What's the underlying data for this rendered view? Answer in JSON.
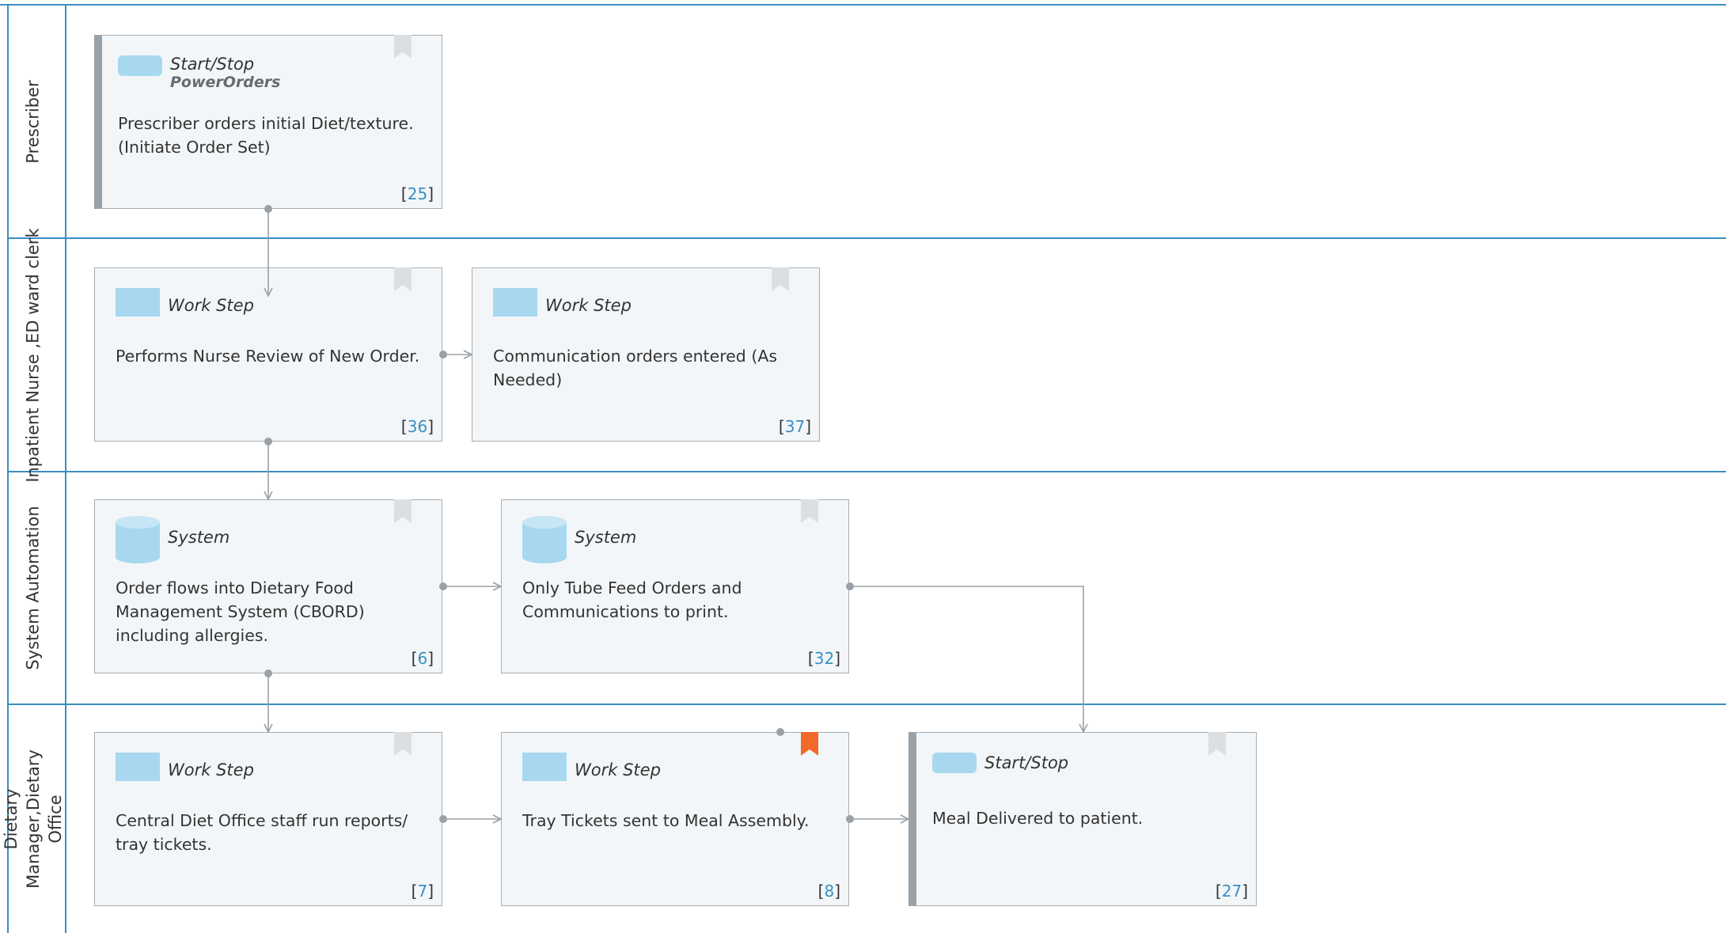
{
  "lanes": [
    {
      "label": "Prescriber"
    },
    {
      "label": "Inpatient Nurse ,ED ward clerk"
    },
    {
      "label": "System Automation"
    },
    {
      "label": "Dietary Manager,Dietary Office"
    }
  ],
  "nodes": [
    {
      "kind": "Start/Stop",
      "subkind": "PowerOrders",
      "desc": "Prescriber orders initial Diet/texture. (Initiate Order Set)",
      "id": "25"
    },
    {
      "kind": "Work Step",
      "desc": "Performs Nurse Review of New Order.",
      "id": "36"
    },
    {
      "kind": "Work Step",
      "desc": "Communication orders entered (As Needed)",
      "id": "37"
    },
    {
      "kind": "System",
      "desc": "Order flows into Dietary Food Management System (CBORD) including allergies.",
      "id": "6"
    },
    {
      "kind": "System",
      "desc": "Only Tube Feed Orders and Communications to print.",
      "id": "32"
    },
    {
      "kind": "Work Step",
      "desc": "Central Diet Office staff run reports/ tray tickets.",
      "id": "7"
    },
    {
      "kind": "Work Step",
      "desc": "Tray Tickets sent to Meal Assembly.",
      "id": "8"
    },
    {
      "kind": "Start/Stop",
      "desc": "Meal Delivered to patient.",
      "id": "27"
    }
  ],
  "colors": {
    "lane_border": "#3a8fc4",
    "connector": "#9aa0a6",
    "icon_fill": "#a7d8ef",
    "bookmark_default": "#dcdfe2",
    "bookmark_flagged": "#f26a2a",
    "id_number": "#3a8fc4"
  },
  "icons": {
    "work_step": "rectangle-icon",
    "start_stop": "rounded-rectangle-icon",
    "system": "database-cylinder-icon",
    "bookmark": "bookmark-icon"
  }
}
